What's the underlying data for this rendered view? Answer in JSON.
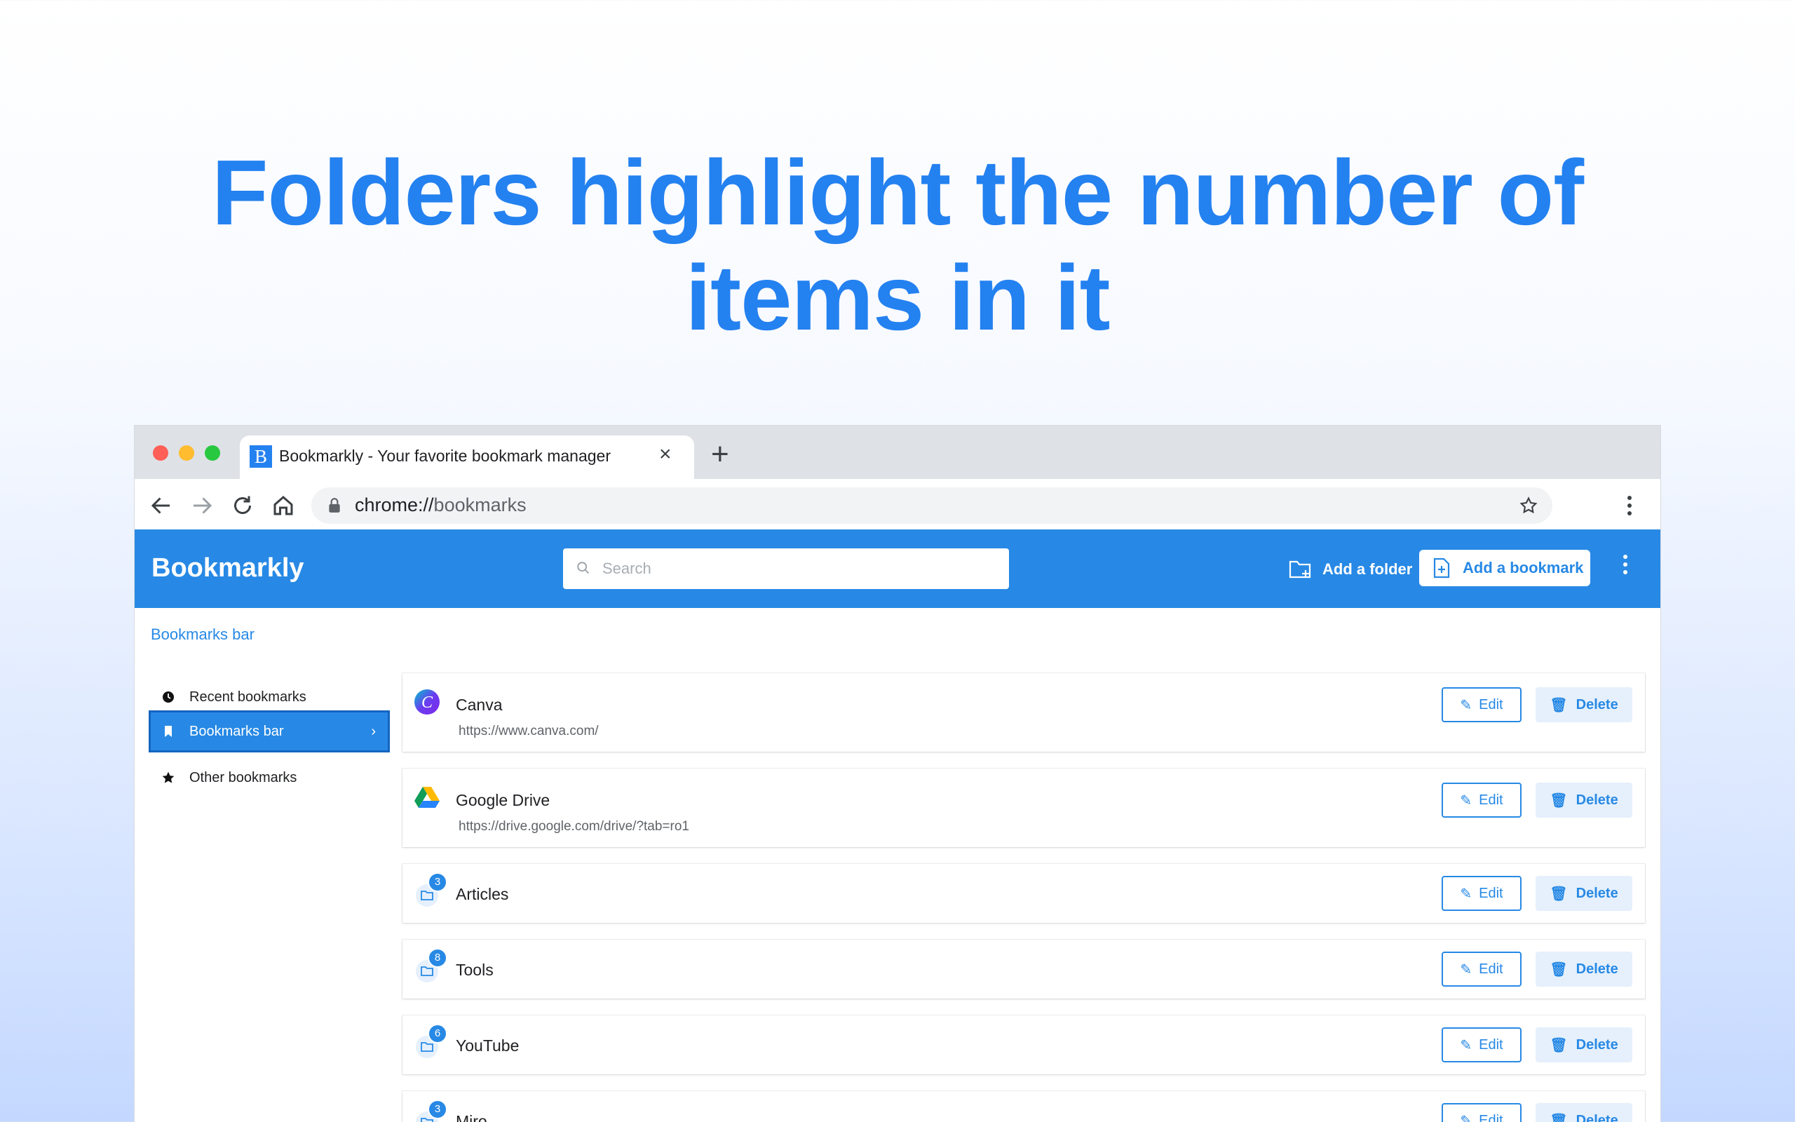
{
  "headline": {
    "line1": "Folders highlight the number of",
    "line2": "items in it"
  },
  "browser": {
    "tab_title": "Bookmarkly - Your favorite bookmark manager",
    "tab_favicon_letter": "B",
    "url_scheme": "chrome://",
    "url_path": "bookmarks",
    "traffic_colors": [
      "#ff5f57",
      "#febc2e",
      "#28c840"
    ]
  },
  "app": {
    "logo": "Bookmarkly",
    "search_placeholder": "Search",
    "add_folder_label": "Add a folder",
    "add_bookmark_label": "Add a bookmark",
    "breadcrumb": "Bookmarks bar",
    "accent": "#2789e5"
  },
  "sidebar": {
    "items": [
      {
        "label": "Recent bookmarks",
        "icon": "clock-icon"
      },
      {
        "label": "Bookmarks bar",
        "icon": "bookmark-icon",
        "active": true
      },
      {
        "label": "Other bookmarks",
        "icon": "star-icon"
      }
    ]
  },
  "list": {
    "edit_label": "Edit",
    "delete_label": "Delete",
    "items": [
      {
        "type": "bookmark",
        "name": "Canva",
        "url": "https://www.canva.com/",
        "icon": "canva-logo"
      },
      {
        "type": "bookmark",
        "name": "Google Drive",
        "url": "https://drive.google.com/drive/?tab=ro1",
        "icon": "google-drive-logo"
      },
      {
        "type": "folder",
        "name": "Articles",
        "count": "3"
      },
      {
        "type": "folder",
        "name": "Tools",
        "count": "8"
      },
      {
        "type": "folder",
        "name": "YouTube",
        "count": "6"
      },
      {
        "type": "folder",
        "name": "Miro",
        "count": "3"
      }
    ]
  }
}
